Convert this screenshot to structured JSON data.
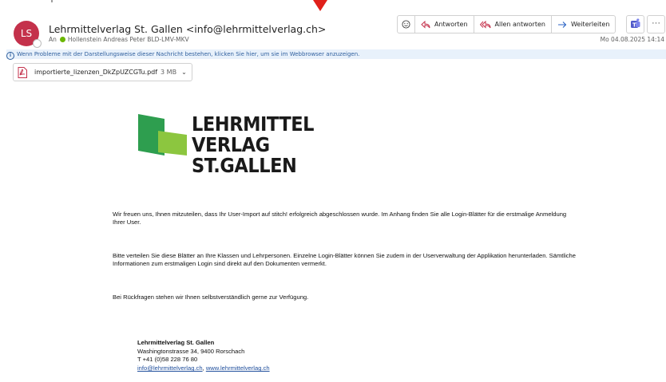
{
  "sender": {
    "initials": "LS",
    "name": "Lehrmittelverlag St. Gallen <info@lehrmittelverlag.ch>",
    "to_label": "An",
    "recipient": "Hollenstein Andreas Peter BLD-LMV-MKV",
    "date": "Mo 04.08.2025 14:14"
  },
  "toolbar": {
    "reply": "Antworten",
    "reply_all": "Allen antworten",
    "forward": "Weiterleiten",
    "more": "···"
  },
  "infobar": {
    "text": "Wenn Probleme mit der Darstellungsweise dieser Nachricht bestehen, klicken Sie hier, um sie im Webbrowser anzuzeigen."
  },
  "attachment": {
    "filename": "importierte_lizenzen_DkZpUZCGTu.pdf",
    "size": "3 MB"
  },
  "logo": {
    "line1": "LEHRMITTEL",
    "line2": "VERLAG",
    "line3": "ST.GALLEN"
  },
  "body": {
    "p1": "Wir freuen uns, Ihnen mitzuteilen, dass Ihr User-Import auf stitch! erfolgreich abgeschlossen wurde. Im Anhang finden Sie alle Login-Blätter für die erstmalige Anmeldung Ihrer User.",
    "p2": "Bitte verteilen Sie diese Blätter an Ihre Klassen und Lehrpersonen. Einzelne Login-Blätter können Sie zudem in der Userverwaltung der Applikation herunterladen. Sämtliche Informationen zum erstmaligen Login sind direkt auf den Dokumenten vermerkt.",
    "p3": "Bei Rückfragen stehen wir Ihnen selbstverständlich gerne zur Verfügung."
  },
  "signature": {
    "company": "Lehrmittelverlag St. Gallen",
    "address": "Washingtonstrasse 34, 9400 Rorschach",
    "phone": "T +41 (0)58 228 76 80",
    "email": "info@lehrmittelverlag.ch",
    "separator": ", ",
    "website": "www.lehrmittelverlag.ch"
  },
  "colors": {
    "avatar": "#c4314b",
    "logo_dark_green": "#2e9e4f",
    "logo_light_green": "#8cc63f",
    "link": "#1f4e9c",
    "infobar_bg": "#e8f1fb"
  }
}
